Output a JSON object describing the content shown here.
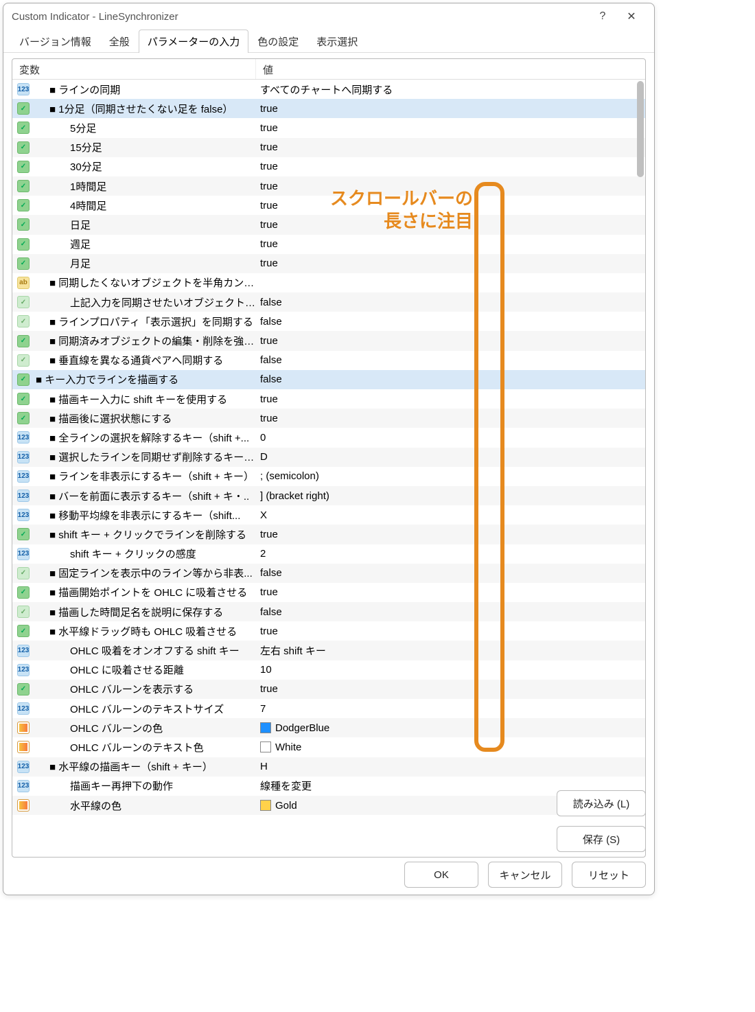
{
  "window": {
    "title": "Custom Indicator - LineSynchronizer",
    "help": "?",
    "close": "✕"
  },
  "tabs": [
    {
      "label": "バージョン情報",
      "active": false
    },
    {
      "label": "全般",
      "active": false
    },
    {
      "label": "パラメーターの入力",
      "active": true
    },
    {
      "label": "色の設定",
      "active": false
    },
    {
      "label": "表示選択",
      "active": false
    }
  ],
  "columns": {
    "variable": "変数",
    "value": "値"
  },
  "rows": [
    {
      "icon": "int",
      "indent": 1,
      "name": "■ ラインの同期",
      "value": "すべてのチャートへ同期する"
    },
    {
      "icon": "boolOn",
      "indent": 1,
      "name": "■ 1分足（同期させたくない足を false）",
      "value": "true",
      "selected": true
    },
    {
      "icon": "boolOn",
      "indent": 2,
      "name": "5分足",
      "value": "true"
    },
    {
      "icon": "boolOn",
      "indent": 2,
      "name": "15分足",
      "value": "true"
    },
    {
      "icon": "boolOn",
      "indent": 2,
      "name": "30分足",
      "value": "true"
    },
    {
      "icon": "boolOn",
      "indent": 2,
      "name": "1時間足",
      "value": "true"
    },
    {
      "icon": "boolOn",
      "indent": 2,
      "name": "4時間足",
      "value": "true"
    },
    {
      "icon": "boolOn",
      "indent": 2,
      "name": "日足",
      "value": "true"
    },
    {
      "icon": "boolOn",
      "indent": 2,
      "name": "週足",
      "value": "true"
    },
    {
      "icon": "boolOn",
      "indent": 2,
      "name": "月足",
      "value": "true"
    },
    {
      "icon": "str",
      "indent": 1,
      "name": "■ 同期したくないオブジェクトを半角カンマ・..",
      "value": ""
    },
    {
      "icon": "boolOff",
      "indent": 2,
      "name": "上記入力を同期させたいオブジェクトに・..",
      "value": "false"
    },
    {
      "icon": "boolOff",
      "indent": 1,
      "name": "■ ラインプロパティ「表示選択」を同期する",
      "value": "false"
    },
    {
      "icon": "boolOn",
      "indent": 1,
      "name": "■ 同期済みオブジェクトの編集・削除を強・..",
      "value": "true"
    },
    {
      "icon": "boolOff",
      "indent": 1,
      "name": "■ 垂直線を異なる通貨ペアへ同期する",
      "value": "false"
    },
    {
      "icon": "boolOn",
      "indent": 0,
      "name": "■ キー入力でラインを描画する",
      "value": "false",
      "selected": true
    },
    {
      "icon": "boolOn",
      "indent": 1,
      "name": "■ 描画キー入力に shift キーを使用する",
      "value": "true"
    },
    {
      "icon": "boolOn",
      "indent": 1,
      "name": "■ 描画後に選択状態にする",
      "value": "true"
    },
    {
      "icon": "int",
      "indent": 1,
      "name": "■ 全ラインの選択を解除するキー（shift +...",
      "value": "0"
    },
    {
      "icon": "int",
      "indent": 1,
      "name": "■ 選択したラインを同期せず削除するキー・..",
      "value": "D"
    },
    {
      "icon": "int",
      "indent": 1,
      "name": "■ ラインを非表示にするキー（shift + キー）",
      "value": "; (semicolon)"
    },
    {
      "icon": "int",
      "indent": 1,
      "name": "■ バーを前面に表示するキー（shift + キ・..",
      "value": "] (bracket right)"
    },
    {
      "icon": "int",
      "indent": 1,
      "name": "■ 移動平均線を非表示にするキー（shift...",
      "value": "X"
    },
    {
      "icon": "boolOn",
      "indent": 1,
      "name": "■ shift キー + クリックでラインを削除する",
      "value": "true"
    },
    {
      "icon": "int",
      "indent": 2,
      "name": "shift キー + クリックの感度",
      "value": "2"
    },
    {
      "icon": "boolOff",
      "indent": 1,
      "name": "■ 固定ラインを表示中のライン等から非表...",
      "value": "false"
    },
    {
      "icon": "boolOn",
      "indent": 1,
      "name": "■ 描画開始ポイントを OHLC に吸着させる",
      "value": "true"
    },
    {
      "icon": "boolOff",
      "indent": 1,
      "name": "■ 描画した時間足名を説明に保存する",
      "value": "false"
    },
    {
      "icon": "boolOn",
      "indent": 1,
      "name": "■ 水平線ドラッグ時も OHLC 吸着させる",
      "value": "true"
    },
    {
      "icon": "int",
      "indent": 2,
      "name": "OHLC 吸着をオンオフする shift キー",
      "value": "左右 shift キー"
    },
    {
      "icon": "int",
      "indent": 2,
      "name": "OHLC に吸着させる距離",
      "value": "10"
    },
    {
      "icon": "boolOn",
      "indent": 2,
      "name": "OHLC バルーンを表示する",
      "value": "true"
    },
    {
      "icon": "int",
      "indent": 2,
      "name": "OHLC バルーンのテキストサイズ",
      "value": "7"
    },
    {
      "icon": "color",
      "indent": 2,
      "name": "OHLC バルーンの色",
      "value": "DodgerBlue",
      "swatch": "#1e90ff"
    },
    {
      "icon": "color",
      "indent": 2,
      "name": "OHLC バルーンのテキスト色",
      "value": "White",
      "swatch": "#ffffff"
    },
    {
      "icon": "int",
      "indent": 1,
      "name": "■ 水平線の描画キー（shift + キー）",
      "value": "H"
    },
    {
      "icon": "int",
      "indent": 2,
      "name": "描画キー再押下の動作",
      "value": "線種を変更"
    },
    {
      "icon": "color",
      "indent": 2,
      "name": "水平線の色",
      "value": "Gold",
      "swatch": "#ffd24a"
    }
  ],
  "side_buttons": {
    "load": "読み込み (L)",
    "save": "保存 (S)"
  },
  "footer": {
    "ok": "OK",
    "cancel": "キャンセル",
    "reset": "リセット"
  },
  "annotation": {
    "line1": "スクロールバーの",
    "line2": "長さに注目"
  }
}
